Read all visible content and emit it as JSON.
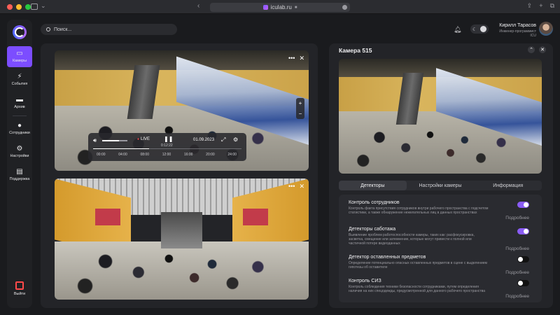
{
  "browser": {
    "url": "iculab.ru"
  },
  "sidebar": {
    "items": [
      {
        "label": "Камеры",
        "icon": "camera-icon",
        "active": true
      },
      {
        "label": "События",
        "icon": "lightning-icon",
        "active": false
      },
      {
        "label": "Архив",
        "icon": "folder-icon",
        "active": false
      },
      {
        "label": "Сотрудники",
        "icon": "person-icon",
        "active": false
      },
      {
        "label": "Настройки",
        "icon": "gear-icon",
        "active": false
      },
      {
        "label": "Поддержка",
        "icon": "chat-icon",
        "active": false
      }
    ],
    "exit_label": "Выйти"
  },
  "header": {
    "search_placeholder": "Поиск...",
    "user_name": "Кирилл Тарасов",
    "user_role": "Инженер-программист ICU"
  },
  "player": {
    "live_label": "LIVE",
    "timer": "0:12:22",
    "date": "01.09.2023",
    "timeline": [
      "00:00",
      "04:00",
      "08:00",
      "12:00",
      "16:00",
      "20:00",
      "24:00"
    ]
  },
  "camera_panel": {
    "title": "Камера 515",
    "tabs": [
      "Детекторы",
      "Настройки камеры",
      "Информация"
    ],
    "more_label": "Подробнее",
    "detectors": [
      {
        "title": "Контроль сотрудников",
        "desc": "Контроль факта присутствия сотрудников внутри рабочего пространства с подсчетом статистики, а также обнаружение нежелательных лиц в данных пространствах",
        "enabled": true
      },
      {
        "title": "Детекторы саботажа",
        "desc": "Выявление проблем работоспособности камеры, таких как: расфокусировка, засветка, смещение или затемнение, которые могут привести к полной или частичной потере видеоданных",
        "enabled": true
      },
      {
        "title": "Детектор оставленных предметов",
        "desc": "Определение потенциально опасных оставленных предметов в сцене с выделением гипотезы об оставителе",
        "enabled": false
      },
      {
        "title": "Контроль СИЗ",
        "desc": "Контроль соблюдения техники безопасности сотрудниками, путем определения наличия на них спецодежды, предусмотренной для данного рабочего пространства",
        "enabled": false
      }
    ]
  },
  "colors": {
    "accent": "#7c4dff",
    "toggle_on": "#8a5cf6",
    "exit": "#ff4a4a"
  }
}
